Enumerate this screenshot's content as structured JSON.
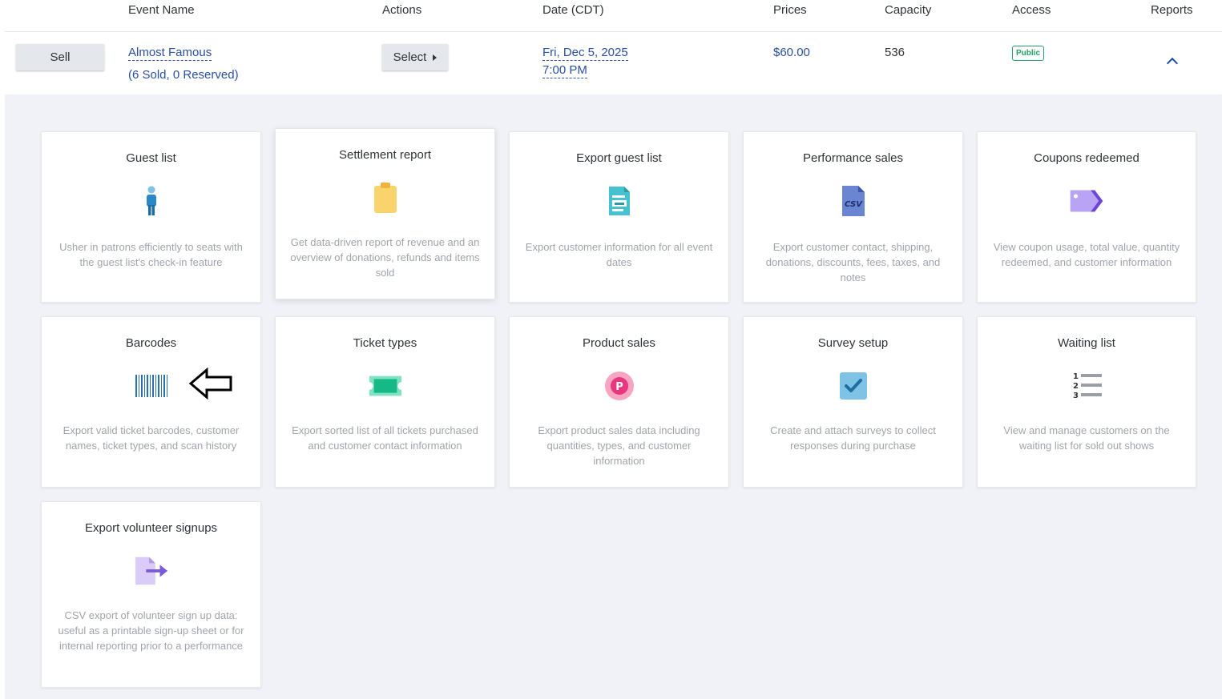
{
  "table_header": {
    "event_name": "Event Name",
    "actions": "Actions",
    "date": "Date (CDT)",
    "prices": "Prices",
    "capacity": "Capacity",
    "access": "Access",
    "reports": "Reports"
  },
  "event": {
    "sell_label": "Sell",
    "name": "Almost Famous",
    "sold_info": "(6 Sold, 0 Reserved)",
    "select_label": "Select",
    "date_line1": "Fri, Dec 5, 2025",
    "date_line2": "7:00 PM",
    "price": "$60.00",
    "capacity": "536",
    "access_badge": "Public"
  },
  "reports": [
    {
      "title": "Guest list",
      "icon": "person-icon",
      "desc": "Usher in patrons efficiently to seats with the guest list's check-in feature"
    },
    {
      "title": "Settlement report",
      "icon": "clipboard-icon",
      "desc": "Get data-driven report of revenue and an overview of donations, refunds and items sold"
    },
    {
      "title": "Export guest list",
      "icon": "document-export-icon",
      "desc": "Export customer information for all event dates"
    },
    {
      "title": "Performance sales",
      "icon": "csv-file-icon",
      "desc": "Export customer contact, shipping, donations, discounts, fees, taxes, and notes"
    },
    {
      "title": "Coupons redeemed",
      "icon": "tag-icon",
      "desc": "View coupon usage, total value, quantity redeemed, and customer information"
    },
    {
      "title": "Barcodes",
      "icon": "barcode-icon",
      "desc": "Export valid ticket barcodes, customer names, ticket types, and scan history"
    },
    {
      "title": "Ticket types",
      "icon": "ticket-icon",
      "desc": "Export sorted list of all tickets purchased and customer contact information"
    },
    {
      "title": "Product sales",
      "icon": "product-p-icon",
      "desc": "Export product sales data including quantities, types, and customer information"
    },
    {
      "title": "Survey setup",
      "icon": "checkbox-icon",
      "desc": "Create and attach surveys to collect responses during purchase"
    },
    {
      "title": "Waiting list",
      "icon": "numbered-list-icon",
      "desc": "View and manage customers on the waiting list for sold out shows"
    },
    {
      "title": "Export volunteer signups",
      "icon": "file-export-icon",
      "desc": "CSV export of volunteer sign up data: useful as a printable sign-up sheet or for internal reporting prior to a performance"
    }
  ],
  "icon_texts": {
    "csv": "CSV",
    "p": "P",
    "list_numbers": [
      "1",
      "2",
      "3"
    ]
  },
  "colors": {
    "link": "#2a4fa0",
    "badge_green": "#21a366",
    "panel_bg": "#f1f2f7"
  }
}
